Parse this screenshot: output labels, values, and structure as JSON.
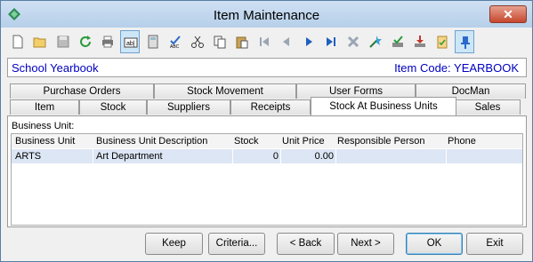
{
  "window": {
    "title": "Item Maintenance",
    "close_label": "✕"
  },
  "toolbar": {
    "icons": [
      "new-icon",
      "open-icon",
      "save-icon",
      "refresh-icon",
      "print-icon",
      "textbox-icon",
      "calculator-icon",
      "spellcheck-icon",
      "cut-icon",
      "copy-icon",
      "paste-icon",
      "first-record-icon",
      "previous-record-icon",
      "next-record-icon",
      "last-record-icon",
      "delete-icon",
      "magic-icon",
      "approve-icon",
      "import-icon",
      "clipboard-icon",
      "pin-icon"
    ]
  },
  "info": {
    "left": "School Yearbook",
    "right": "Item Code: YEARBOOK"
  },
  "tabs_back": [
    "Purchase Orders",
    "Stock Movement",
    "User Forms",
    "DocMan"
  ],
  "tabs_front": [
    "Item",
    "Stock",
    "Suppliers",
    "Receipts",
    "Stock At Business Units",
    "Sales"
  ],
  "panel": {
    "label": "Business Unit:",
    "columns": [
      "Business Unit",
      "Business Unit Description",
      "Stock",
      "Unit Price",
      "Responsible Person",
      "Phone"
    ],
    "rows": [
      [
        "ARTS",
        "Art Department",
        "0",
        "0.00",
        "",
        ""
      ]
    ]
  },
  "buttons": {
    "keep": "Keep",
    "criteria": "Criteria...",
    "back": "< Back",
    "next": "Next >",
    "ok": "OK",
    "exit": "Exit"
  }
}
